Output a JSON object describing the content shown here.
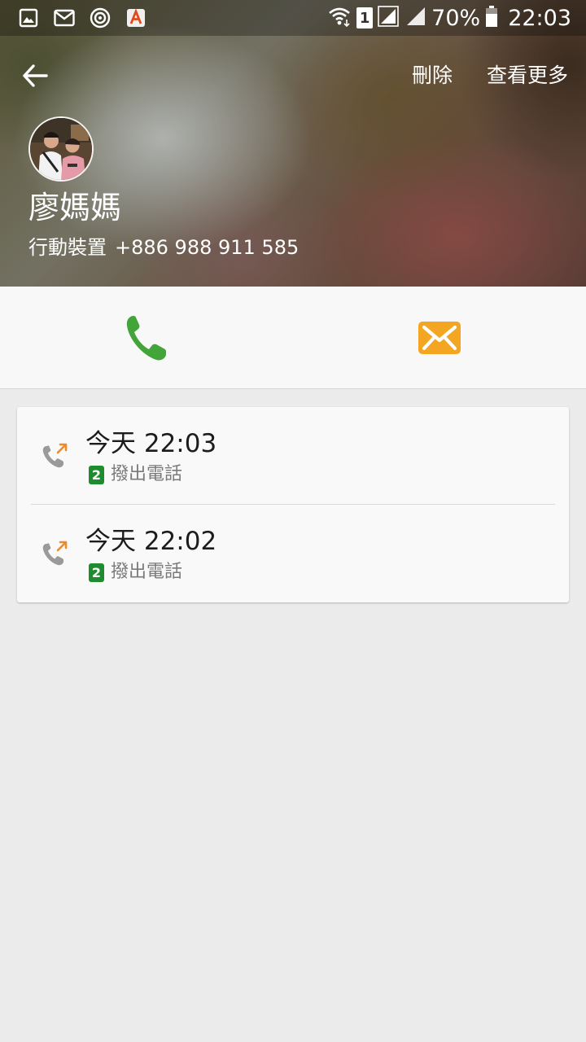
{
  "status_bar": {
    "left_icons": [
      "gallery-icon",
      "gmail-icon",
      "target-icon",
      "a-app-icon"
    ],
    "sim_label": "1",
    "battery_percent": "70%",
    "time": "22:03"
  },
  "header": {
    "delete_label": "刪除",
    "more_label": "查看更多",
    "contact_name": "廖媽媽",
    "number_type": "行動裝置",
    "phone_number": "+886 988 911 585"
  },
  "actions": {
    "call_icon": "phone-icon",
    "message_icon": "envelope-icon",
    "call_color": "#43a43a",
    "message_color": "#f4a623"
  },
  "call_log": [
    {
      "time": "今天 22:03",
      "sim": "2",
      "type": "撥出電話"
    },
    {
      "time": "今天 22:02",
      "sim": "2",
      "type": "撥出電話"
    }
  ],
  "colors": {
    "outgoing_arrow": "#f08a24",
    "sim_badge": "#1e8c2e"
  }
}
